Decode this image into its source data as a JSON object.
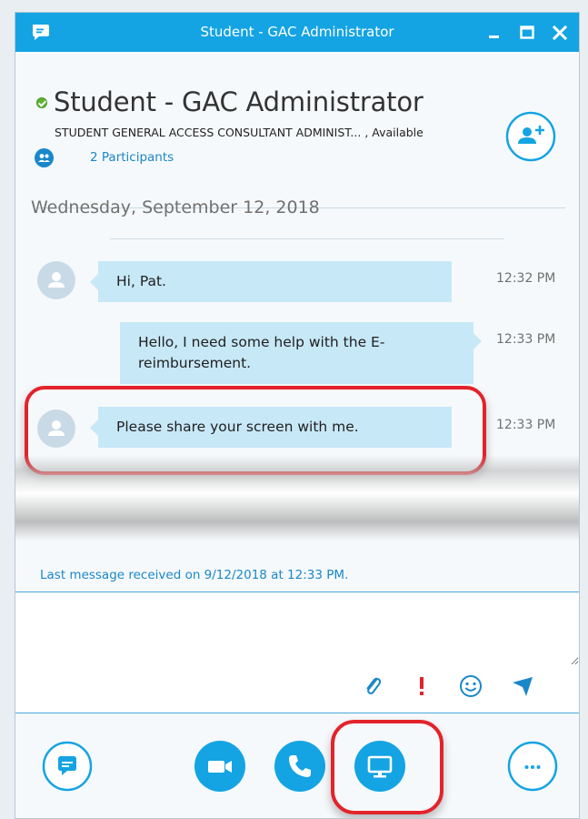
{
  "window": {
    "title": "Student - GAC Administrator"
  },
  "contact": {
    "name": "Student - GAC Administrator",
    "subtitle": "STUDENT GENERAL ACCESS CONSULTANT ADMINIST... , Available",
    "participants": "2 Participants",
    "status_color": "#5cb230"
  },
  "conversation": {
    "date": "Wednesday, September 12, 2018",
    "messages": [
      {
        "direction": "incoming",
        "text": "Hi, Pat.",
        "time": "12:32 PM"
      },
      {
        "direction": "outgoing",
        "text": "Hello, I need some help with the E-reimbursement.",
        "time": "12:33 PM"
      },
      {
        "direction": "incoming",
        "text": "Please share your screen with me.",
        "time": "12:33 PM"
      }
    ],
    "last_message": "Last message received on 9/12/2018 at 12:33 PM."
  },
  "compose": {
    "value": "",
    "icons": [
      "paperclip-icon",
      "exclamation-icon",
      "smiley-icon",
      "send-icon"
    ]
  },
  "toolbar": {
    "buttons": [
      "chat-bubble-icon",
      "video-camera-icon",
      "phone-icon",
      "screen-share-icon",
      "more-options-icon"
    ]
  },
  "colors": {
    "accent": "#14a4e3",
    "bubble": "#c7e8f7",
    "link": "#1a87c9",
    "highlight": "#e3232b"
  }
}
